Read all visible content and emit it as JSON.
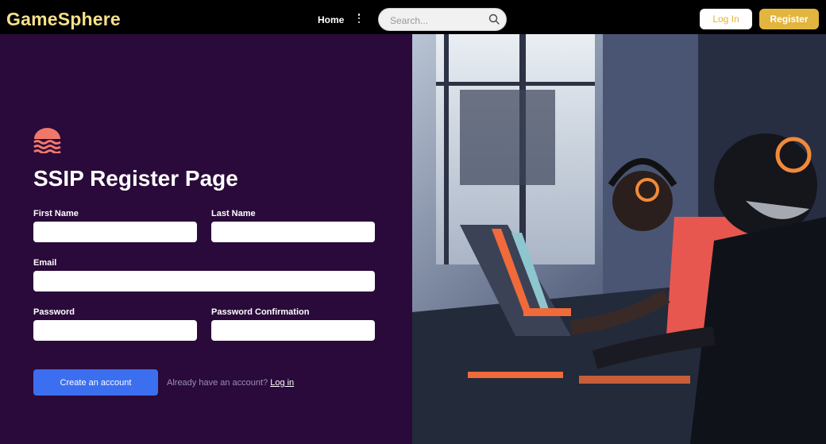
{
  "app": {
    "brand": "GameSphere"
  },
  "nav": {
    "home_label": "Home"
  },
  "search": {
    "placeholder": "Search..."
  },
  "auth": {
    "login_label": "Log In",
    "register_label": "Register"
  },
  "form": {
    "title": "SSIP Register Page",
    "first_name_label": "First Name",
    "last_name_label": "Last Name",
    "email_label": "Email",
    "password_label": "Password",
    "password_confirmation_label": "Password Confirmation",
    "submit_label": "Create an account",
    "already_text": "Already have an account?",
    "login_link": "Log in"
  },
  "colors": {
    "brand": "#f5e08a",
    "panel_bg": "#2a0a3a",
    "primary_button": "#3b6ff0",
    "register_button": "#e2b53f"
  },
  "icons": {
    "logo": "waves-sun-icon",
    "search": "search-icon",
    "more": "more-vertical-icon"
  },
  "hero_image": {
    "subject": "people gaming on laptops with headphones"
  }
}
